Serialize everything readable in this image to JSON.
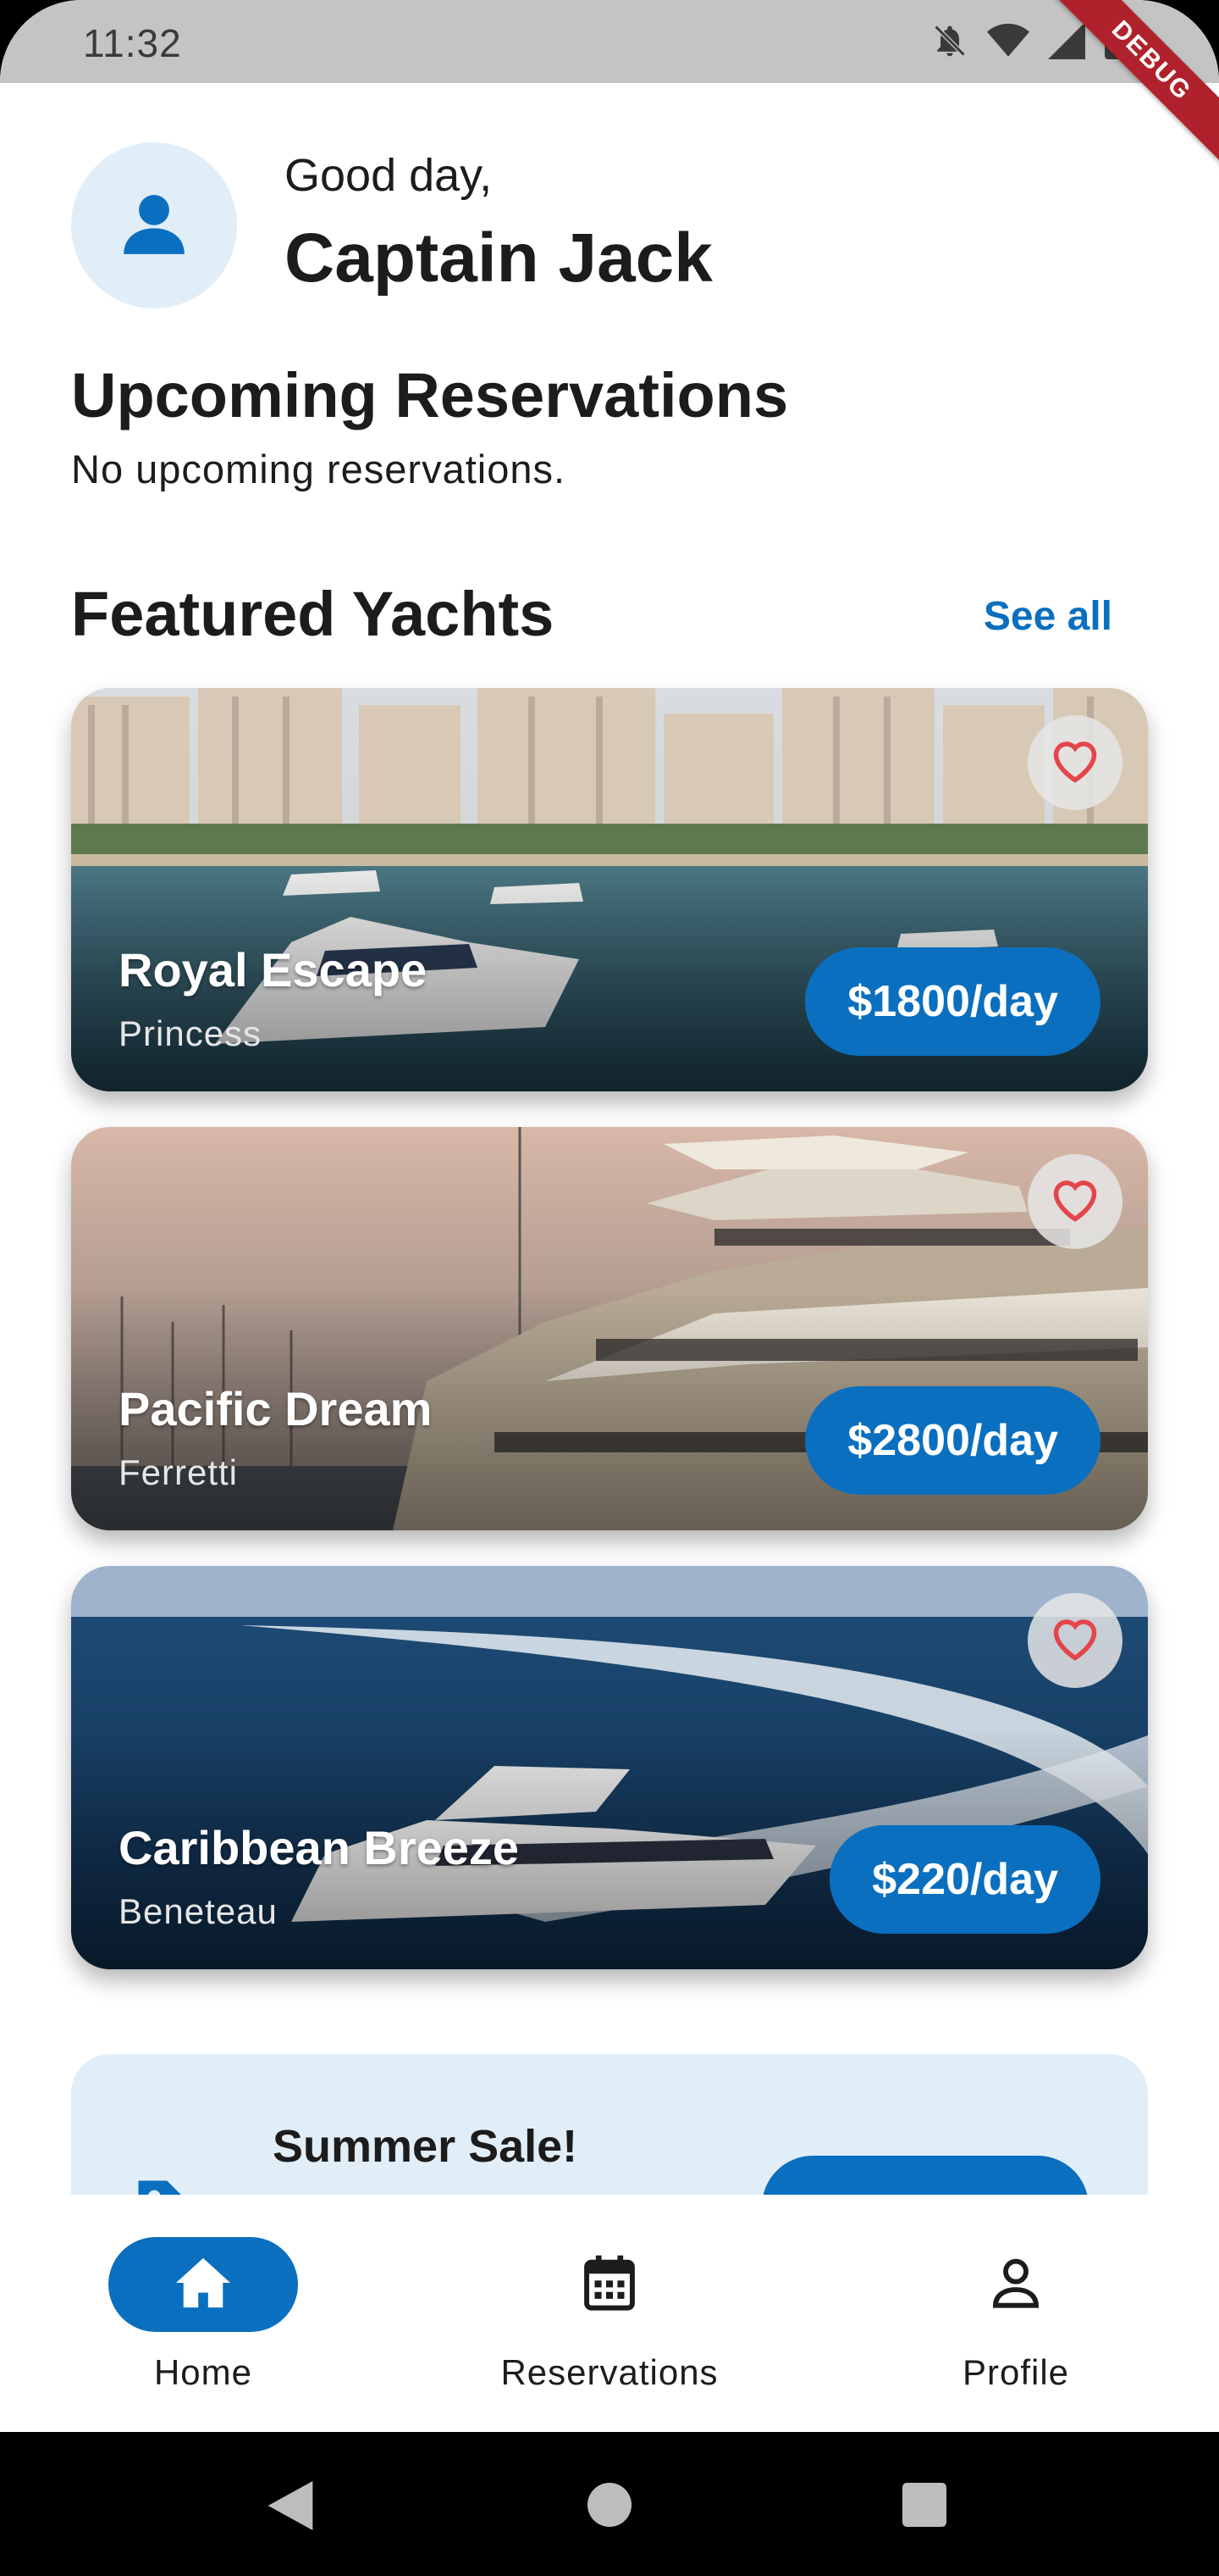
{
  "status_bar": {
    "time": "11:32",
    "debug_label": "DEBUG"
  },
  "header": {
    "greeting": "Good day,",
    "user_name": "Captain Jack"
  },
  "reservations": {
    "title": "Upcoming Reservations",
    "empty_text": "No upcoming reservations."
  },
  "featured": {
    "title": "Featured Yachts",
    "see_all_label": "See all",
    "yachts": [
      {
        "name": "Royal Escape",
        "brand": "Princess",
        "price": "$1800/day"
      },
      {
        "name": "Pacific Dream",
        "brand": "Ferretti",
        "price": "$2800/day"
      },
      {
        "name": "Caribbean Breeze",
        "brand": "Beneteau",
        "price": "$220/day"
      }
    ]
  },
  "promo": {
    "title": "Summer Sale!"
  },
  "bottom_nav": {
    "items": [
      {
        "label": "Home",
        "icon": "home-icon",
        "active": true
      },
      {
        "label": "Reservations",
        "icon": "calendar-icon",
        "active": false
      },
      {
        "label": "Profile",
        "icon": "person-icon",
        "active": false
      }
    ]
  },
  "colors": {
    "accent": "#0b6fbf",
    "avatar_bg": "#e1eef8",
    "heart": "#e4454a"
  }
}
